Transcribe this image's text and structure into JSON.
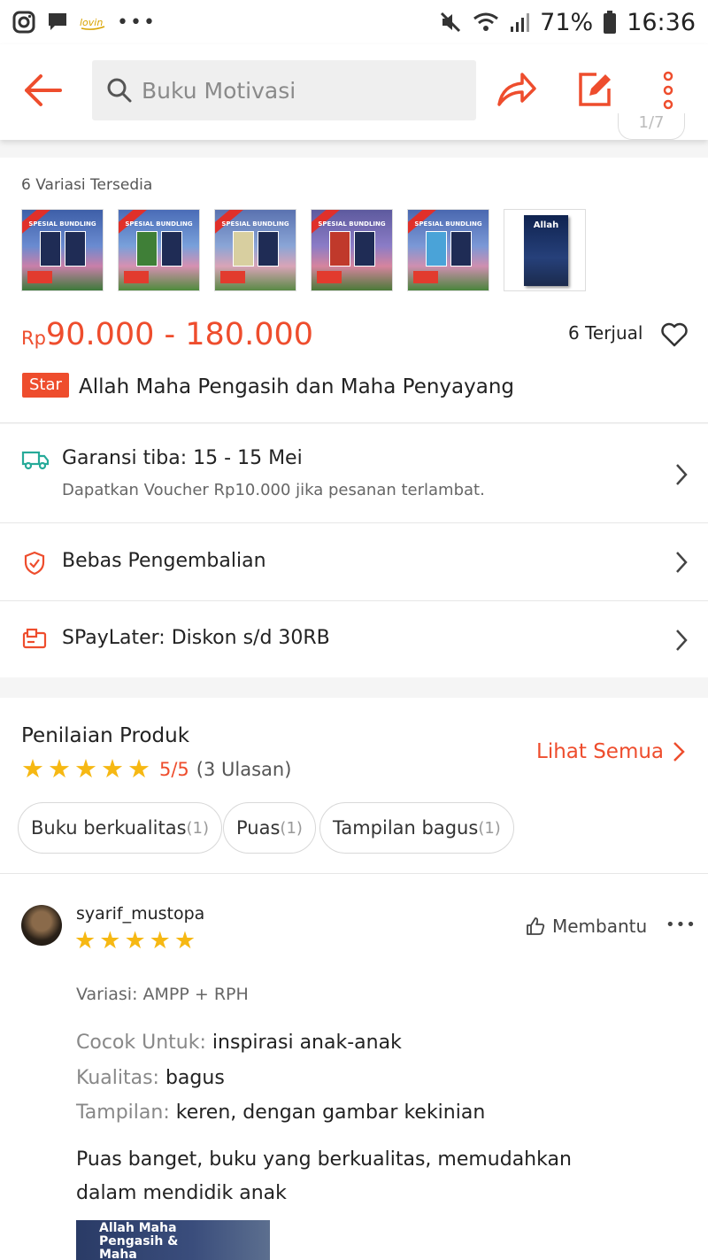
{
  "status_bar": {
    "battery": "71%",
    "time": "16:36"
  },
  "header": {
    "search_placeholder": "Buku Motivasi",
    "image_counter": "1/7"
  },
  "variants": {
    "title": "6 Variasi Tersedia",
    "thumb_cover_text": "SPESIAL BUNDLING",
    "last_book_title": "Allah"
  },
  "product": {
    "price_currency": "Rp",
    "price_range": "90.000 - 180.000",
    "sold": "6 Terjual",
    "badge": "Star",
    "name": "Allah Maha Pengasih dan Maha Penyayang"
  },
  "shipping": {
    "title": "Garansi tiba: 15 - 15 Mei",
    "subtitle": "Dapatkan Voucher Rp10.000 jika pesanan terlambat."
  },
  "returns": {
    "title": "Bebas Pengembalian"
  },
  "paylater": {
    "title": "SPayLater: Diskon s/d 30RB"
  },
  "reviews": {
    "section_title": "Penilaian Produk",
    "see_all": "Lihat Semua",
    "rating_value": "5/5",
    "rating_count": "(3 Ulasan)",
    "stars": 5,
    "tags": [
      {
        "label": "Buku berkualitas",
        "count": "(1)"
      },
      {
        "label": "Puas",
        "count": "(1)"
      },
      {
        "label": "Tampilan bagus",
        "count": "(1)"
      }
    ]
  },
  "review_item": {
    "username": "syarif_mustopa",
    "stars": 5,
    "helpful": "Membantu",
    "variation": "Variasi: AMPP + RPH",
    "fit_label": "Cocok Untuk:",
    "fit_value": "inspirasi anak-anak",
    "quality_label": "Kualitas:",
    "quality_value": "bagus",
    "look_label": "Tampilan:",
    "look_value": "keren, dengan gambar kekinian",
    "comment": "Puas banget, buku yang berkualitas, memudahkan dalam mendidik anak",
    "photo_text": "Allah Maha Pengasih & Maha Penyayang"
  },
  "colors": {
    "accent": "#ee4d2d",
    "star": "#f6b813"
  }
}
